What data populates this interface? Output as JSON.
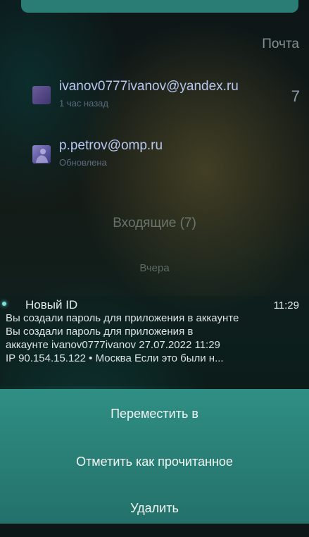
{
  "header": {
    "title": "Почта"
  },
  "accounts": [
    {
      "email": "ivanov0777ivanov@yandex.ru",
      "status": "1 час назад",
      "unread_count": "7"
    },
    {
      "email": "p.petrov@omp.ru",
      "status": "Обновлена"
    }
  ],
  "folder": {
    "title": "Входящие (7)"
  },
  "date_section": "Вчера",
  "message": {
    "sender": "Новый ID",
    "time": "11:29",
    "subject": "Вы создали пароль для приложения в аккаунте",
    "preview_lines": [
      "Вы создали пароль для приложения в",
      "аккаунте ivanov0777ivanov 27.07.2022 11:29",
      "IP 90.154.15.122 • Москва Если это были н..."
    ]
  },
  "context_menu": {
    "move_label": "Переместить в",
    "mark_read_label": "Отметить как прочитанное",
    "delete_label": "Удалить"
  },
  "colors": {
    "menu_background": "#2a8177",
    "email_text": "#b9c7f0",
    "unread_indicator": "#7be0d8"
  }
}
